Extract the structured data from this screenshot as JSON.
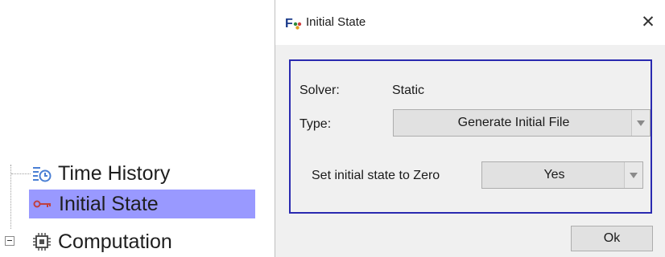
{
  "tree": {
    "items": [
      {
        "label": "Time History",
        "icon": "time-history-icon"
      },
      {
        "label": "Initial State",
        "icon": "key-icon",
        "selected": true
      },
      {
        "label": "Computation",
        "icon": "chip-icon",
        "expandable": true
      }
    ],
    "selected_color": "#9999ff"
  },
  "dialog": {
    "title": "Initial State",
    "logo_text": "F",
    "solver_label": "Solver:",
    "solver_value": "Static",
    "type_label": "Type:",
    "type_selected": "Generate Initial File",
    "zero_label": "Set initial state to Zero",
    "zero_selected": "Yes",
    "ok_label": "Ok",
    "group_border_color": "#2a2ab0"
  }
}
